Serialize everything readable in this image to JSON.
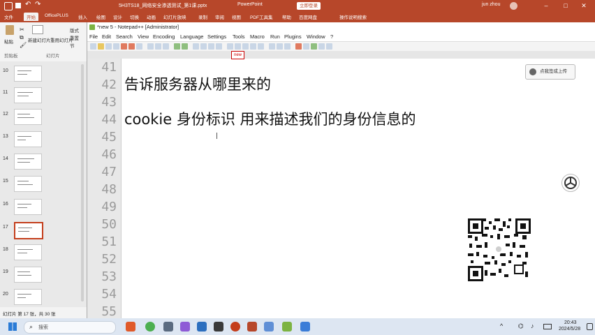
{
  "ppt": {
    "title_left": "5H3TS18_网络安全渗透测试_第1课.pptx",
    "app_name": "PowerPoint",
    "login_chip": "立即登录",
    "user": "jun zhou",
    "tabs": [
      "文件",
      "开始",
      "OfficePLUS",
      "插入",
      "绘图",
      "设计",
      "切换",
      "动画",
      "幻灯片放映",
      "录制",
      "审阅",
      "视图",
      "PDF工具集",
      "帮助",
      "百度网盘"
    ],
    "search_placeholder": "操作说明搜索",
    "ribbon": {
      "paste": "粘贴",
      "clipboard": "剪贴板",
      "new_slide": "新建幻灯片",
      "reuse": "重用幻灯片",
      "slides_group": "幻灯片",
      "layout": "版式",
      "reset": "重置",
      "section": "节"
    },
    "slide_numbers": [
      "10",
      "11",
      "12",
      "13",
      "14",
      "15",
      "16",
      "17",
      "18",
      "19",
      "20"
    ],
    "status": "幻灯片 第 17 张，共 30 张"
  },
  "npp": {
    "title": "*new 5 - Notepad++ [Administrator]",
    "menu": [
      "File",
      "Edit",
      "Search",
      "View",
      "Encoding",
      "Language",
      "Settings",
      "Tools",
      "Macro",
      "Run",
      "Plugins",
      "Window",
      "?"
    ],
    "tab_label": "new",
    "line_numbers": [
      "41",
      "42",
      "43",
      "44",
      "45",
      "46",
      "47",
      "48",
      "49",
      "50",
      "51",
      "52",
      "53",
      "54",
      "55"
    ],
    "lines": {
      "l42": "告诉服务器从哪里来的",
      "l44": "cookie 身份标识 用来描述我们的身份信息的"
    }
  },
  "overlay": {
    "button_label": "点我签成上传"
  },
  "taskbar": {
    "search_placeholder": "搜索",
    "time": "20:43",
    "date": "2024/5/28"
  },
  "colors": {
    "ppt_accent": "#b7472a",
    "selected_slide_border": "#c43e1c",
    "gutter_bg": "#e8e8e8"
  }
}
